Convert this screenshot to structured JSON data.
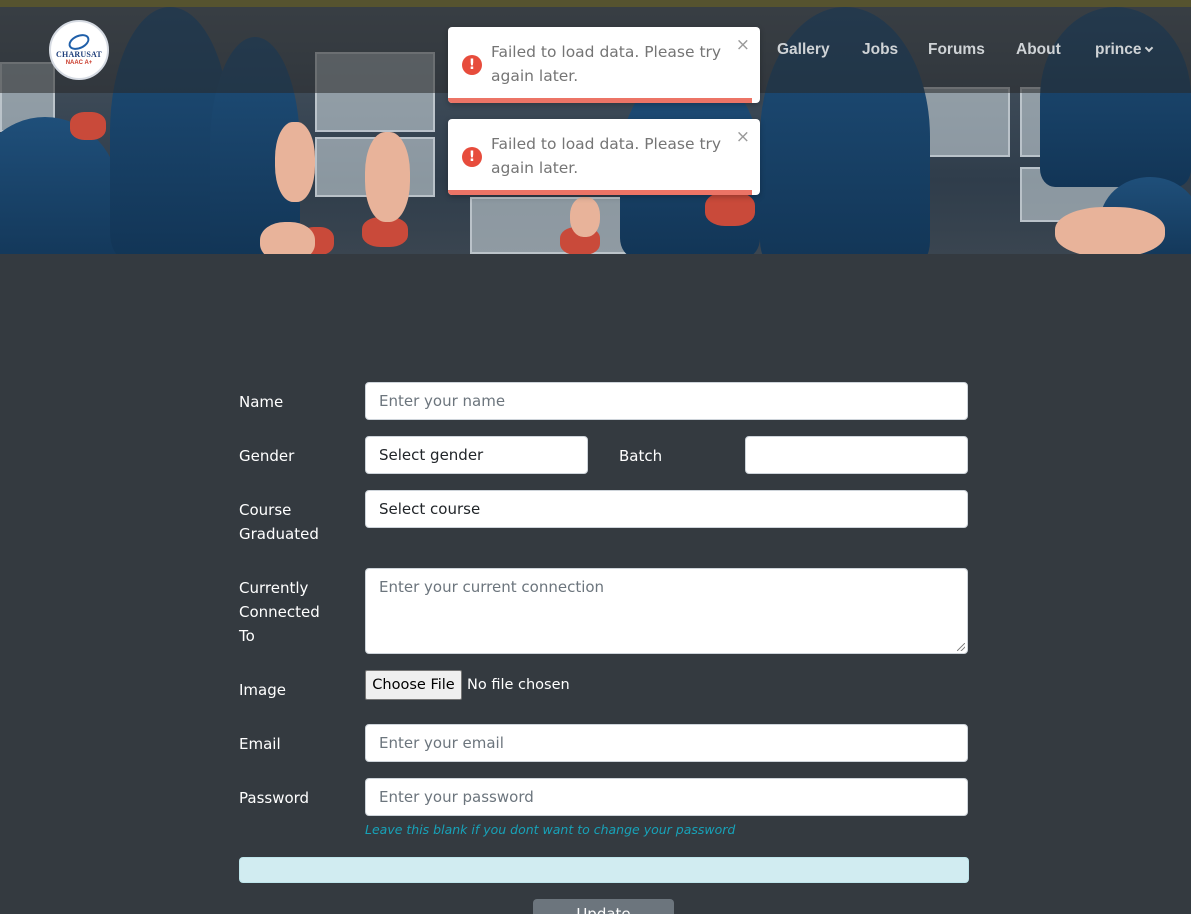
{
  "navbar": {
    "logo_text": "CHARUSAT",
    "logo_badge": "NAAC A+",
    "links": [
      "Gallery",
      "Jobs",
      "Forums",
      "About"
    ],
    "user_menu_label": "prince"
  },
  "toasts": [
    {
      "message": "Failed to load data. Please try again later.",
      "close": "×",
      "icon": "!"
    },
    {
      "message": "Failed to load data. Please try again later.",
      "close": "×",
      "icon": "!"
    }
  ],
  "form": {
    "name": {
      "label": "Name",
      "placeholder": "Enter your name"
    },
    "gender": {
      "label": "Gender",
      "value": "Select gender"
    },
    "batch": {
      "label": "Batch",
      "value": ""
    },
    "course": {
      "label": "Course Graduated",
      "value": "Select course"
    },
    "connection": {
      "label": "Currently Connected To",
      "placeholder": "Enter your current connection"
    },
    "image": {
      "label": "Image",
      "button": "Choose File",
      "status": "No file chosen"
    },
    "email": {
      "label": "Email",
      "placeholder": "Enter your email"
    },
    "password": {
      "label": "Password",
      "placeholder": "Enter your password",
      "hint": "Leave this blank if you dont want to change your password"
    },
    "submit_label": "Update"
  },
  "colors": {
    "page_bg": "#343a40",
    "toast_error": "#e74c3c",
    "toast_progress": "#ec7466",
    "hint": "#17a2b8",
    "alert_bg": "#d1ecf1",
    "submit_bg": "#6c757d"
  }
}
